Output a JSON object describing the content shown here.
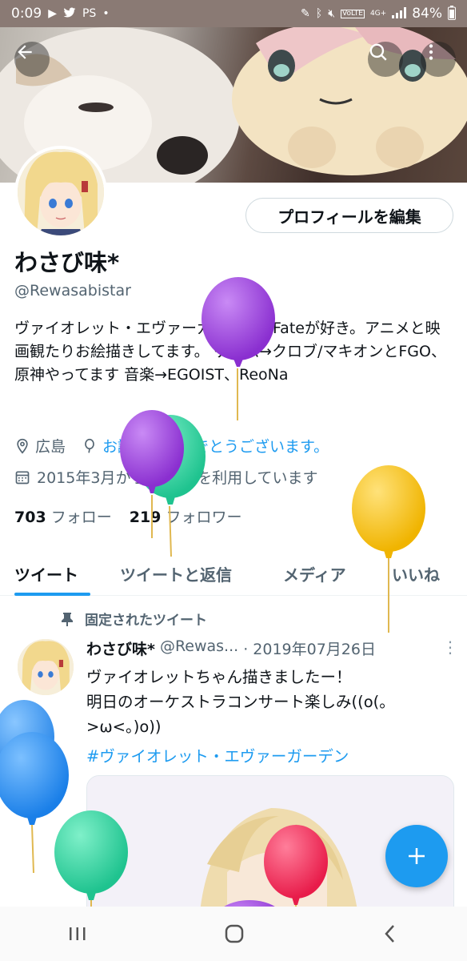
{
  "status_bar": {
    "time": "0:09",
    "signal_label": "4G+",
    "volte": "VoLTE",
    "battery": "84%"
  },
  "profile": {
    "edit_button": "プロフィールを編集",
    "display_name": "わさび味*",
    "handle": "@Rewasabistar",
    "bio": "ヴァイオレット・エヴァーガーデンとFateが好き。アニメと映画観たりお絵描きしてます。 ゲーム→クロブ/マキオンとFGO、原神やってます 音楽→EGOIST、ReoNa",
    "location": "広島",
    "birthday_text": "お誕生日おめでとうございます。",
    "joined": "2015年3月からTwitterを利用しています",
    "following_count": "703",
    "following_label": "フォロー",
    "followers_count": "219",
    "followers_label": "フォロワー"
  },
  "tabs": [
    "ツイート",
    "ツイートと返信",
    "メディア",
    "いいね"
  ],
  "tweet": {
    "pinned_label": "固定されたツイート",
    "name": "わさび味*",
    "handle": "@Rewas...",
    "date": "· 2019年07月26日",
    "text_line1": "ヴァイオレットちゃん描きましたー！",
    "text_line2": "明日のオーケストラコンサート楽しみ((o(。>ω<。)o))",
    "hashtag": "#ヴァイオレット・エヴァーガーデン"
  },
  "colors": {
    "accent": "#1d9bf0",
    "balloon_purple": "#a046e0",
    "balloon_teal": "#3ed9a8",
    "balloon_yellow": "#f5c518",
    "balloon_blue": "#2b8ef0",
    "balloon_red": "#f0385f"
  }
}
